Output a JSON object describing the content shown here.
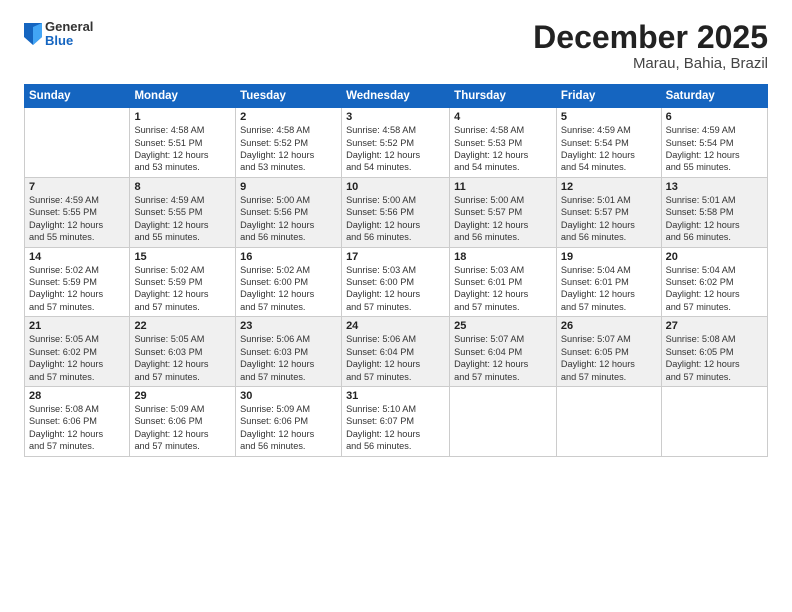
{
  "header": {
    "logo_general": "General",
    "logo_blue": "Blue",
    "month_title": "December 2025",
    "location": "Marau, Bahia, Brazil"
  },
  "days_of_week": [
    "Sunday",
    "Monday",
    "Tuesday",
    "Wednesday",
    "Thursday",
    "Friday",
    "Saturday"
  ],
  "weeks": [
    [
      {
        "day": "",
        "info": ""
      },
      {
        "day": "1",
        "info": "Sunrise: 4:58 AM\nSunset: 5:51 PM\nDaylight: 12 hours\nand 53 minutes."
      },
      {
        "day": "2",
        "info": "Sunrise: 4:58 AM\nSunset: 5:52 PM\nDaylight: 12 hours\nand 53 minutes."
      },
      {
        "day": "3",
        "info": "Sunrise: 4:58 AM\nSunset: 5:52 PM\nDaylight: 12 hours\nand 54 minutes."
      },
      {
        "day": "4",
        "info": "Sunrise: 4:58 AM\nSunset: 5:53 PM\nDaylight: 12 hours\nand 54 minutes."
      },
      {
        "day": "5",
        "info": "Sunrise: 4:59 AM\nSunset: 5:54 PM\nDaylight: 12 hours\nand 54 minutes."
      },
      {
        "day": "6",
        "info": "Sunrise: 4:59 AM\nSunset: 5:54 PM\nDaylight: 12 hours\nand 55 minutes."
      }
    ],
    [
      {
        "day": "7",
        "info": "Sunrise: 4:59 AM\nSunset: 5:55 PM\nDaylight: 12 hours\nand 55 minutes."
      },
      {
        "day": "8",
        "info": "Sunrise: 4:59 AM\nSunset: 5:55 PM\nDaylight: 12 hours\nand 55 minutes."
      },
      {
        "day": "9",
        "info": "Sunrise: 5:00 AM\nSunset: 5:56 PM\nDaylight: 12 hours\nand 56 minutes."
      },
      {
        "day": "10",
        "info": "Sunrise: 5:00 AM\nSunset: 5:56 PM\nDaylight: 12 hours\nand 56 minutes."
      },
      {
        "day": "11",
        "info": "Sunrise: 5:00 AM\nSunset: 5:57 PM\nDaylight: 12 hours\nand 56 minutes."
      },
      {
        "day": "12",
        "info": "Sunrise: 5:01 AM\nSunset: 5:57 PM\nDaylight: 12 hours\nand 56 minutes."
      },
      {
        "day": "13",
        "info": "Sunrise: 5:01 AM\nSunset: 5:58 PM\nDaylight: 12 hours\nand 56 minutes."
      }
    ],
    [
      {
        "day": "14",
        "info": "Sunrise: 5:02 AM\nSunset: 5:59 PM\nDaylight: 12 hours\nand 57 minutes."
      },
      {
        "day": "15",
        "info": "Sunrise: 5:02 AM\nSunset: 5:59 PM\nDaylight: 12 hours\nand 57 minutes."
      },
      {
        "day": "16",
        "info": "Sunrise: 5:02 AM\nSunset: 6:00 PM\nDaylight: 12 hours\nand 57 minutes."
      },
      {
        "day": "17",
        "info": "Sunrise: 5:03 AM\nSunset: 6:00 PM\nDaylight: 12 hours\nand 57 minutes."
      },
      {
        "day": "18",
        "info": "Sunrise: 5:03 AM\nSunset: 6:01 PM\nDaylight: 12 hours\nand 57 minutes."
      },
      {
        "day": "19",
        "info": "Sunrise: 5:04 AM\nSunset: 6:01 PM\nDaylight: 12 hours\nand 57 minutes."
      },
      {
        "day": "20",
        "info": "Sunrise: 5:04 AM\nSunset: 6:02 PM\nDaylight: 12 hours\nand 57 minutes."
      }
    ],
    [
      {
        "day": "21",
        "info": "Sunrise: 5:05 AM\nSunset: 6:02 PM\nDaylight: 12 hours\nand 57 minutes."
      },
      {
        "day": "22",
        "info": "Sunrise: 5:05 AM\nSunset: 6:03 PM\nDaylight: 12 hours\nand 57 minutes."
      },
      {
        "day": "23",
        "info": "Sunrise: 5:06 AM\nSunset: 6:03 PM\nDaylight: 12 hours\nand 57 minutes."
      },
      {
        "day": "24",
        "info": "Sunrise: 5:06 AM\nSunset: 6:04 PM\nDaylight: 12 hours\nand 57 minutes."
      },
      {
        "day": "25",
        "info": "Sunrise: 5:07 AM\nSunset: 6:04 PM\nDaylight: 12 hours\nand 57 minutes."
      },
      {
        "day": "26",
        "info": "Sunrise: 5:07 AM\nSunset: 6:05 PM\nDaylight: 12 hours\nand 57 minutes."
      },
      {
        "day": "27",
        "info": "Sunrise: 5:08 AM\nSunset: 6:05 PM\nDaylight: 12 hours\nand 57 minutes."
      }
    ],
    [
      {
        "day": "28",
        "info": "Sunrise: 5:08 AM\nSunset: 6:06 PM\nDaylight: 12 hours\nand 57 minutes."
      },
      {
        "day": "29",
        "info": "Sunrise: 5:09 AM\nSunset: 6:06 PM\nDaylight: 12 hours\nand 57 minutes."
      },
      {
        "day": "30",
        "info": "Sunrise: 5:09 AM\nSunset: 6:06 PM\nDaylight: 12 hours\nand 56 minutes."
      },
      {
        "day": "31",
        "info": "Sunrise: 5:10 AM\nSunset: 6:07 PM\nDaylight: 12 hours\nand 56 minutes."
      },
      {
        "day": "",
        "info": ""
      },
      {
        "day": "",
        "info": ""
      },
      {
        "day": "",
        "info": ""
      }
    ]
  ]
}
